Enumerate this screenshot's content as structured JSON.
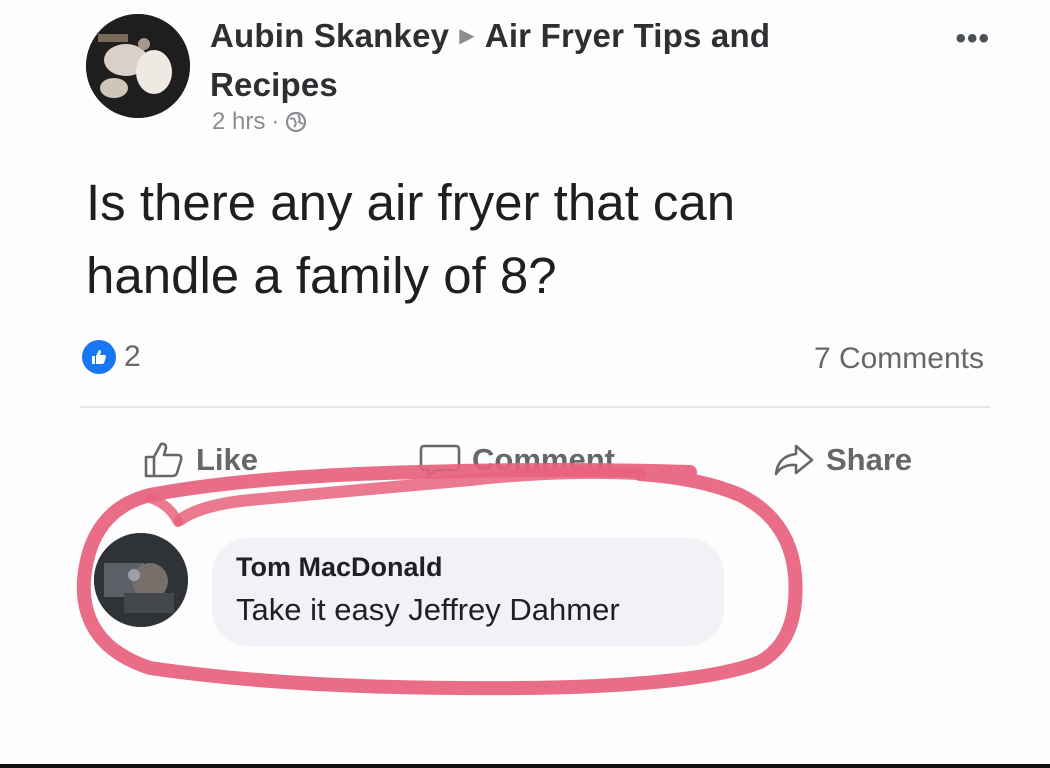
{
  "post": {
    "author": "Aubin Skankey",
    "group": "Air Fryer Tips and",
    "group_line2": "Recipes",
    "time": "2 hrs",
    "separator": "·",
    "text_line1": "Is there any air fryer that can",
    "text_line2": "handle a family of 8?",
    "reaction_count": "2",
    "comments_count": "7 Comments",
    "more_icon": "•••"
  },
  "actions": {
    "like": "Like",
    "comment": "Comment",
    "share": "Share"
  },
  "comment": {
    "author": "Tom MacDonald",
    "text": "Take it easy Jeffrey Dahmer"
  },
  "icons": {
    "arrow": "▶",
    "globe": "globe-icon",
    "like_badge": "thumbs-up-icon"
  },
  "colors": {
    "like_blue": "#1877f2",
    "annotation_pink": "#e8617d",
    "secondary_text": "#65676b"
  }
}
